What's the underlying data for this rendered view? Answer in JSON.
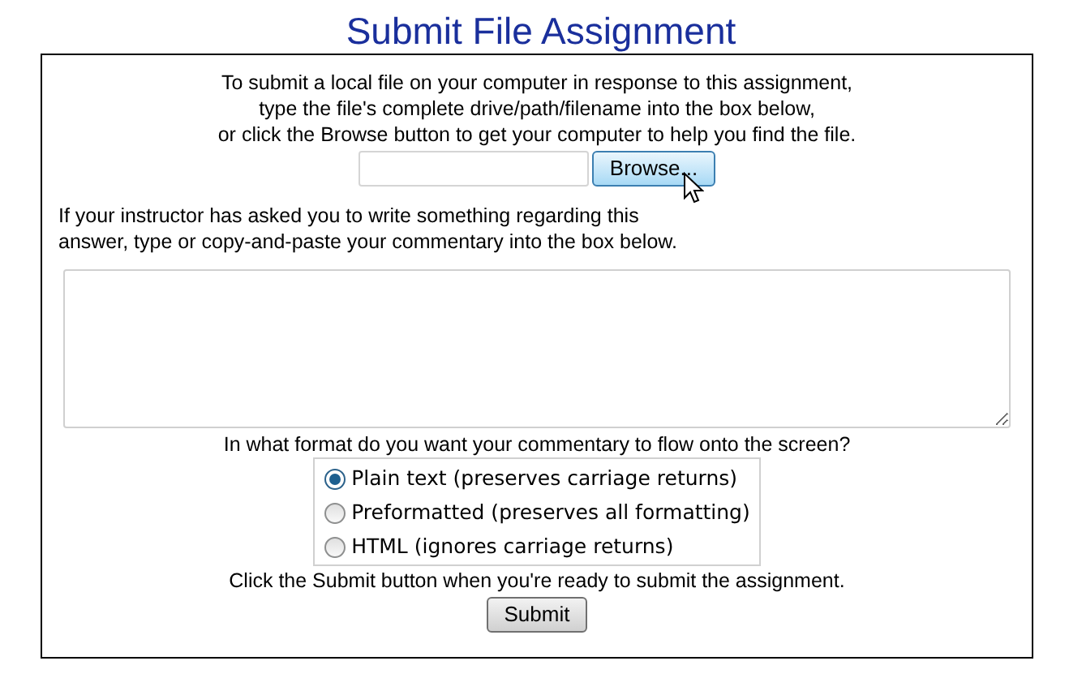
{
  "title": "Submit File Assignment",
  "file_instructions": [
    "To submit a local file on your computer in response to this assignment,",
    "type the file's complete drive/path/filename into the box below,",
    "or click the Browse button to get your computer to help you find the file."
  ],
  "browse_button": {
    "label": "Browse...",
    "hovered": true
  },
  "commentary_instructions": [
    "If your instructor has asked you to write something regarding this",
    "answer, type or copy-and-paste your commentary into the box below."
  ],
  "format_question": "In what format do you want your commentary to flow onto the screen?",
  "format_options": [
    {
      "label": "Plain text (preserves carriage returns)",
      "selected": true
    },
    {
      "label": "Preformatted (preserves all formatting)",
      "selected": false
    },
    {
      "label": "HTML (ignores carriage returns)",
      "selected": false
    }
  ],
  "submit_instructions": "Click the Submit button when you're ready to submit the assignment.",
  "submit_button": "Submit"
}
